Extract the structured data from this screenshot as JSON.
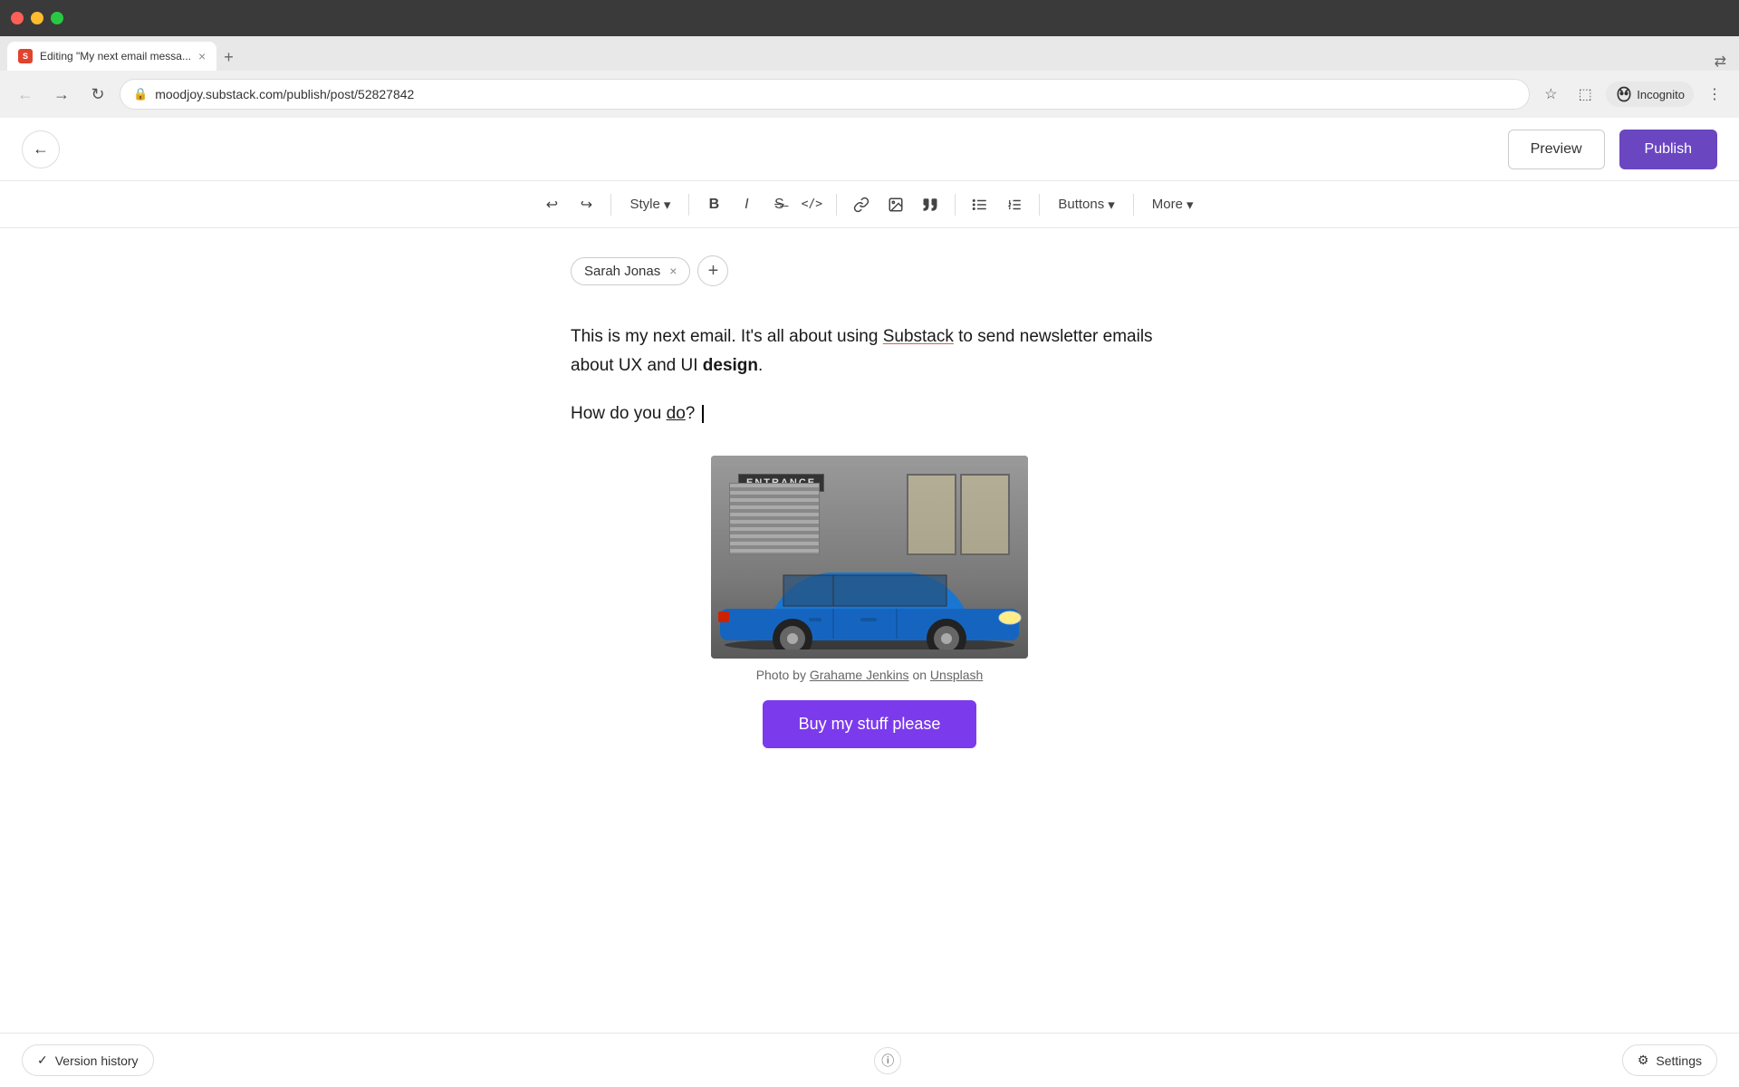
{
  "browser": {
    "tab_title": "Editing \"My next email messa...",
    "url": "moodjoy.substack.com/publish/post/52827842",
    "tab_close": "×",
    "tab_new": "+",
    "nav_back": "←",
    "nav_forward": "→",
    "nav_refresh": "↻",
    "lock_icon": "🔒",
    "bookmark_icon": "☆",
    "extension_icon": "⬚",
    "profile_label": "Incognito",
    "more_icon": "⋮",
    "ext_arrows": "⇄"
  },
  "header": {
    "back_icon": "←",
    "preview_label": "Preview",
    "publish_label": "Publish"
  },
  "toolbar": {
    "undo": "↩",
    "redo": "↪",
    "style_label": "Style",
    "bold": "B",
    "italic": "I",
    "strikethrough": "S̶",
    "code": "</>",
    "link": "🔗",
    "image": "🖼",
    "quote": "❝",
    "bullet_list": "≡",
    "numbered_list": "⋮",
    "buttons_label": "Buttons",
    "more_label": "More"
  },
  "author": {
    "name": "Sarah Jonas",
    "close": "×",
    "add": "+"
  },
  "content": {
    "paragraph1": "This is my next email. It's all about using ",
    "substack_link": "Substack",
    "paragraph1_end": " to send newsletter emails about UX and UI ",
    "bold_word": "design",
    "paragraph1_dot": ".",
    "paragraph2": "How do you ",
    "underline_word": "do",
    "paragraph2_end": "?"
  },
  "image": {
    "caption_pre": "Photo by ",
    "photographer": "Grahame Jenkins",
    "caption_mid": " on ",
    "platform": "Unsplash"
  },
  "buy_button": {
    "label": "Buy my stuff please"
  },
  "bottom": {
    "version_history": "Version history",
    "check_icon": "✓",
    "info_icon": "ⓘ",
    "settings_label": "Settings",
    "settings_icon": "⚙"
  }
}
